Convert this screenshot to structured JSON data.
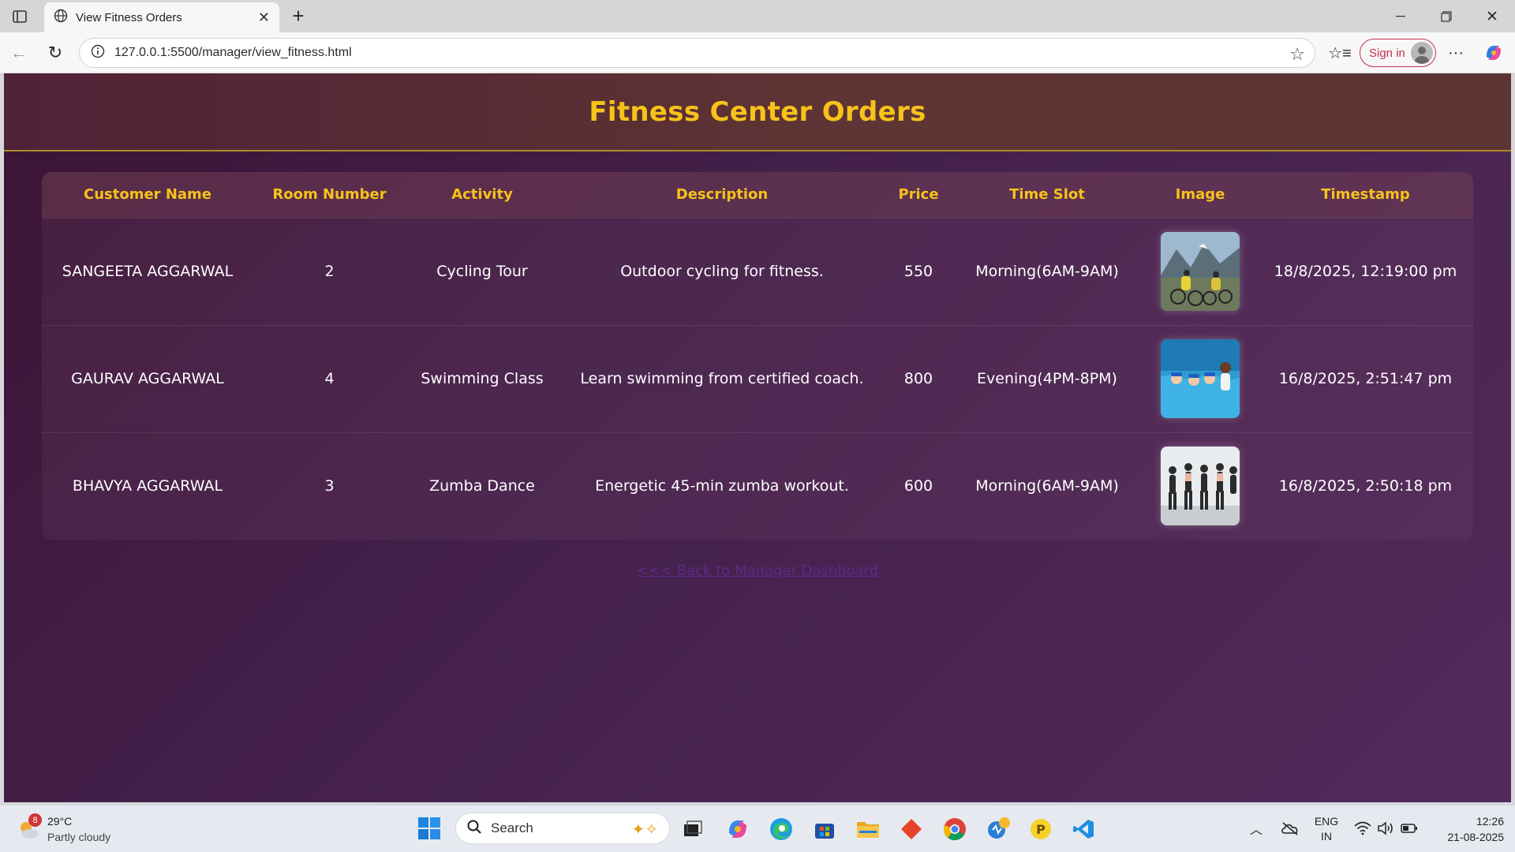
{
  "browser": {
    "tab_title": "View Fitness Orders",
    "url": "127.0.0.1:5500/manager/view_fitness.html",
    "signin_label": "Sign in"
  },
  "page": {
    "title": "Fitness Center Orders",
    "back_link": "<<< Back to Manager Dashboard",
    "accent_color": "#f7c21a"
  },
  "table": {
    "headers": [
      "Customer Name",
      "Room Number",
      "Activity",
      "Description",
      "Price",
      "Time Slot",
      "Image",
      "Timestamp"
    ],
    "rows": [
      {
        "customer": "SANGEETA AGGARWAL",
        "room": "2",
        "activity": "Cycling Tour",
        "description": "Outdoor cycling for fitness.",
        "price": "550",
        "slot": "Morning(6AM-9AM)",
        "image": "cycling-photo",
        "timestamp": "18/8/2025, 12:19:00 pm"
      },
      {
        "customer": "GAURAV AGGARWAL",
        "room": "4",
        "activity": "Swimming Class",
        "description": "Learn swimming from certified coach.",
        "price": "800",
        "slot": "Evening(4PM-8PM)",
        "image": "swimming-photo",
        "timestamp": "16/8/2025, 2:51:47 pm"
      },
      {
        "customer": "BHAVYA AGGARWAL",
        "room": "3",
        "activity": "Zumba Dance",
        "description": "Energetic 45-min zumba workout.",
        "price": "600",
        "slot": "Morning(6AM-9AM)",
        "image": "zumba-photo",
        "timestamp": "16/8/2025, 2:50:18 pm"
      }
    ]
  },
  "taskbar": {
    "weather_badge": "8",
    "temperature": "29°C",
    "weather": "Partly cloudy",
    "search_placeholder": "Search",
    "lang_top": "ENG",
    "lang_bottom": "IN",
    "time": "12:26",
    "date": "21-08-2025"
  }
}
